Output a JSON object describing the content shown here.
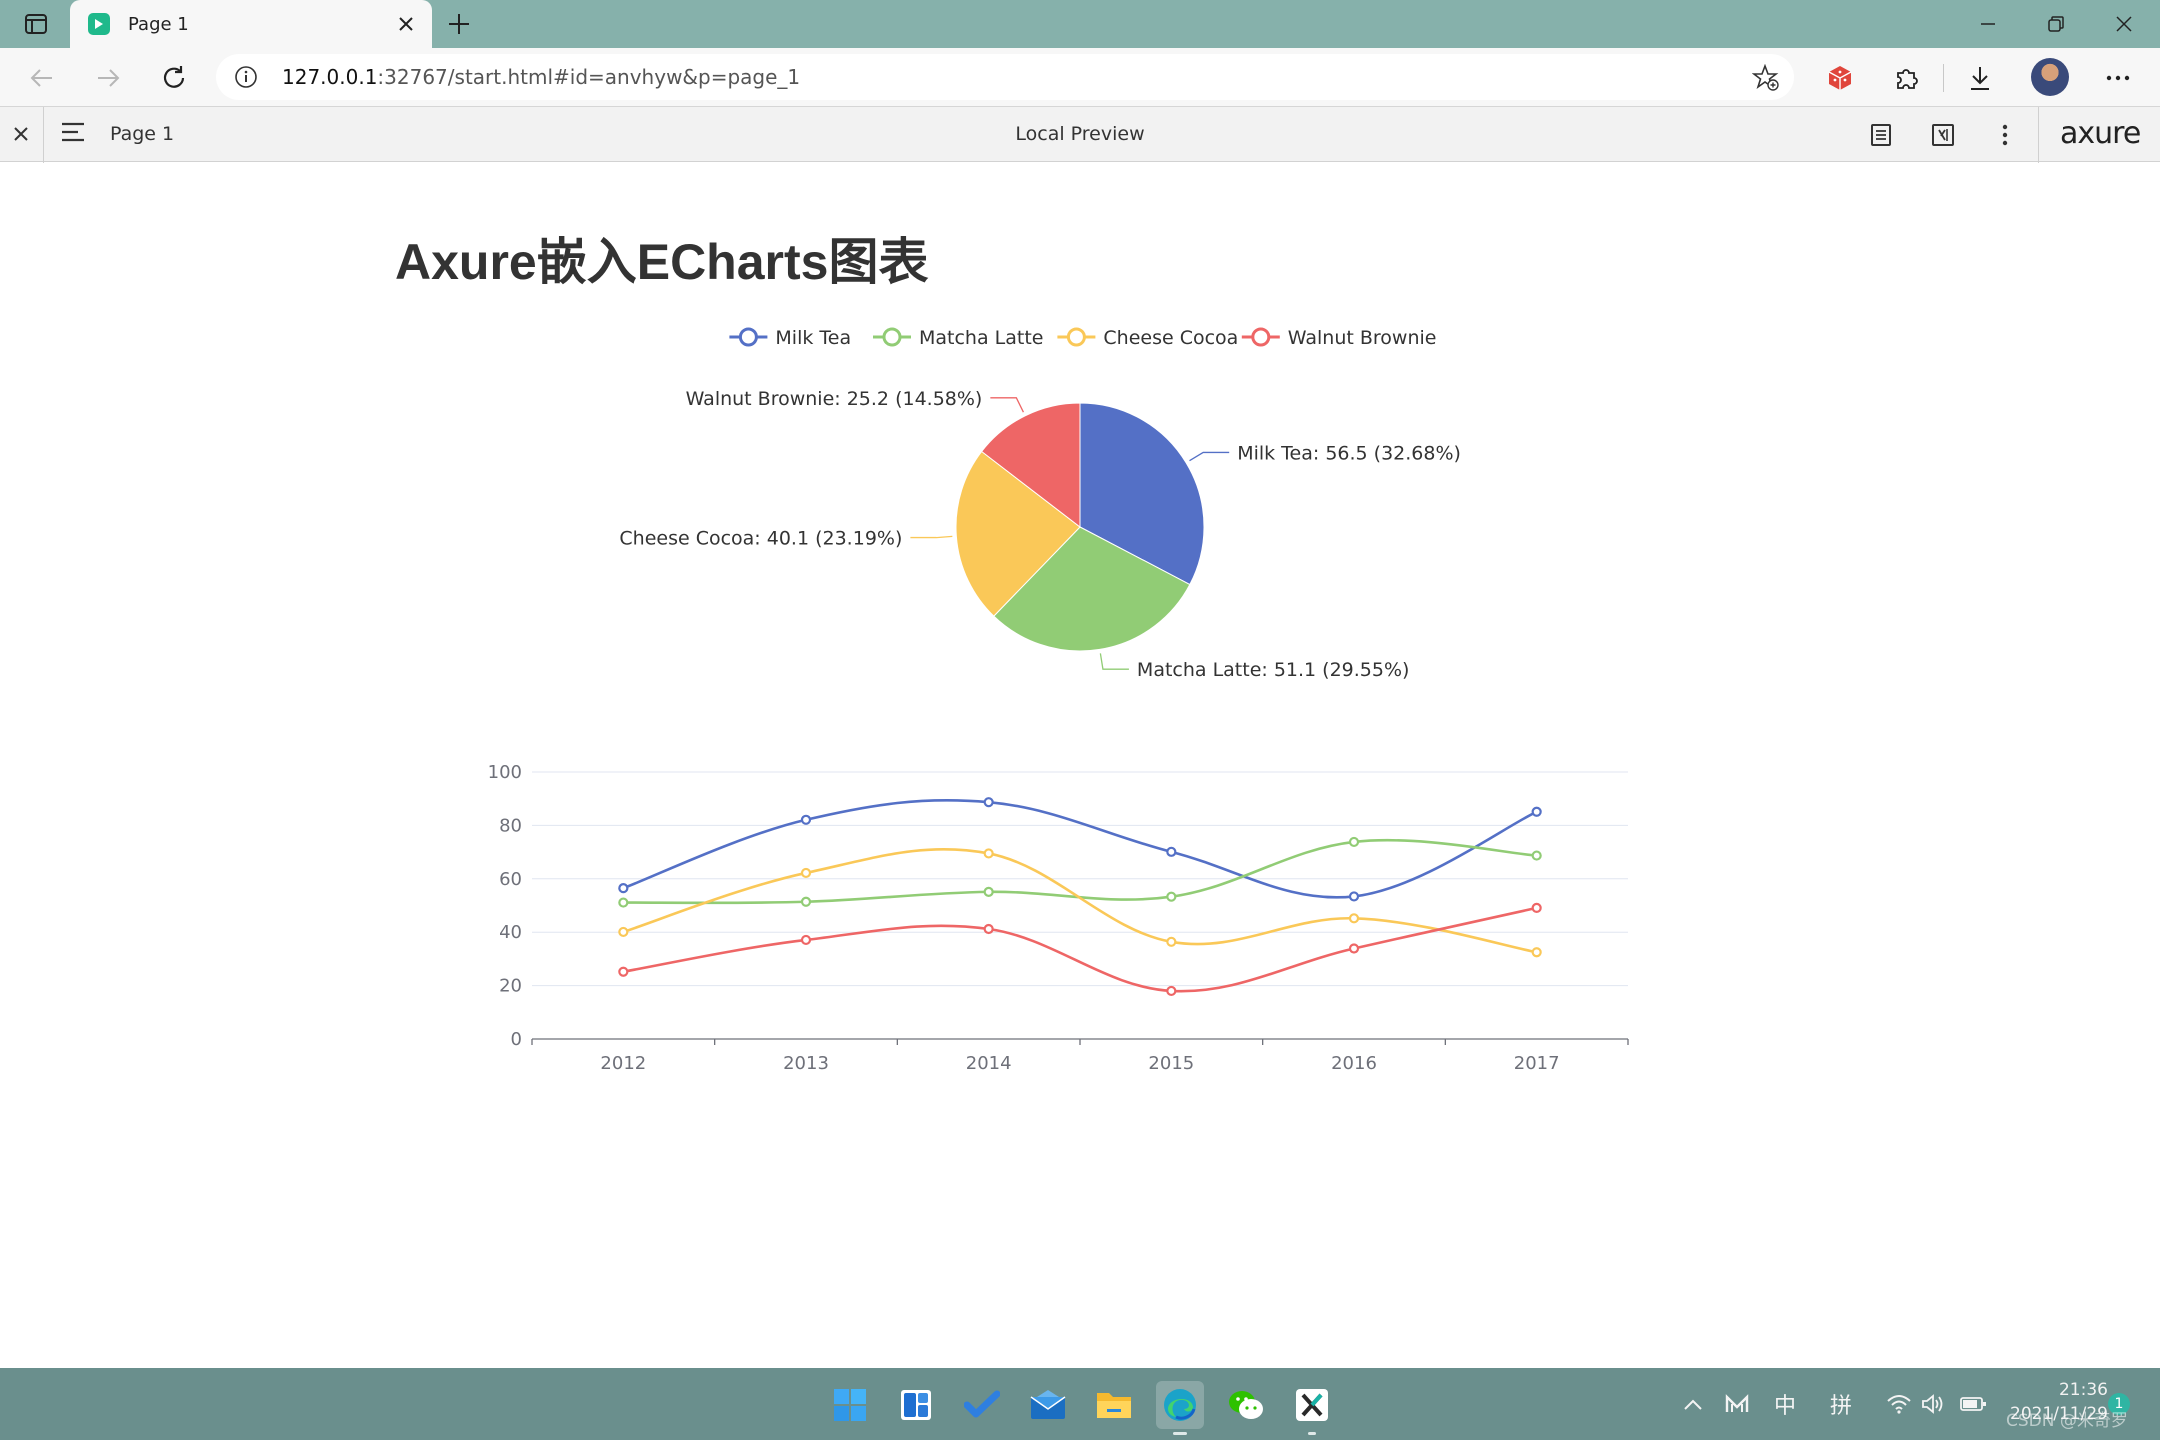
{
  "browser": {
    "tab_title": "Page 1",
    "url_host": "127.0.0.1",
    "url_path": ":32767/start.html#id=anvhyw&p=page_1"
  },
  "axure": {
    "page_label": "Page 1",
    "title": "Local Preview",
    "logo": "axure"
  },
  "page": {
    "title": "Axure嵌入ECharts图表"
  },
  "colors": {
    "milk_tea": "#5470c6",
    "matcha_latte": "#91cc75",
    "cheese_cocoa": "#fac858",
    "walnut_brownie": "#ee6666",
    "tabstrip": "#86b1ab",
    "taskbar": "#6a8f8d"
  },
  "chart_data": [
    {
      "type": "pie",
      "legend": [
        "Milk Tea",
        "Matcha Latte",
        "Cheese Cocoa",
        "Walnut Brownie"
      ],
      "legend_position": "top",
      "slices": [
        {
          "name": "Milk Tea",
          "value": 56.5,
          "percent": "32.68%",
          "label": "Milk Tea: 56.5 (32.68%)"
        },
        {
          "name": "Matcha Latte",
          "value": 51.1,
          "percent": "29.55%",
          "label": "Matcha Latte: 51.1 (29.55%)"
        },
        {
          "name": "Cheese Cocoa",
          "value": 40.1,
          "percent": "23.19%",
          "label": "Cheese Cocoa: 40.1 (23.19%)"
        },
        {
          "name": "Walnut Brownie",
          "value": 25.2,
          "percent": "14.58%",
          "label": "Walnut Brownie: 25.2 (14.58%)"
        }
      ]
    },
    {
      "type": "line",
      "smooth": true,
      "categories": [
        "2012",
        "2013",
        "2014",
        "2015",
        "2016",
        "2017"
      ],
      "ylim": [
        0,
        100
      ],
      "yticks": [
        0,
        20,
        40,
        60,
        80,
        100
      ],
      "grid": true,
      "series": [
        {
          "name": "Milk Tea",
          "values": [
            56.5,
            82.1,
            88.7,
            70.1,
            53.4,
            85.1
          ]
        },
        {
          "name": "Matcha Latte",
          "values": [
            51.1,
            51.4,
            55.1,
            53.3,
            73.8,
            68.7
          ]
        },
        {
          "name": "Cheese Cocoa",
          "values": [
            40.1,
            62.2,
            69.5,
            36.4,
            45.2,
            32.5
          ]
        },
        {
          "name": "Walnut Brownie",
          "values": [
            25.2,
            37.1,
            41.2,
            18.0,
            33.9,
            49.1
          ]
        }
      ]
    }
  ],
  "taskbar": {
    "apps": [
      "start-menu",
      "widgets",
      "todo",
      "mail",
      "file-explorer",
      "edge-browser",
      "wechat",
      "axure-rp"
    ],
    "ime_mode": "中",
    "ime_input": "拼",
    "time": "21:36",
    "date": "2021/11/29",
    "notification_count": "1",
    "watermark": "CSDN @米奇罗"
  }
}
